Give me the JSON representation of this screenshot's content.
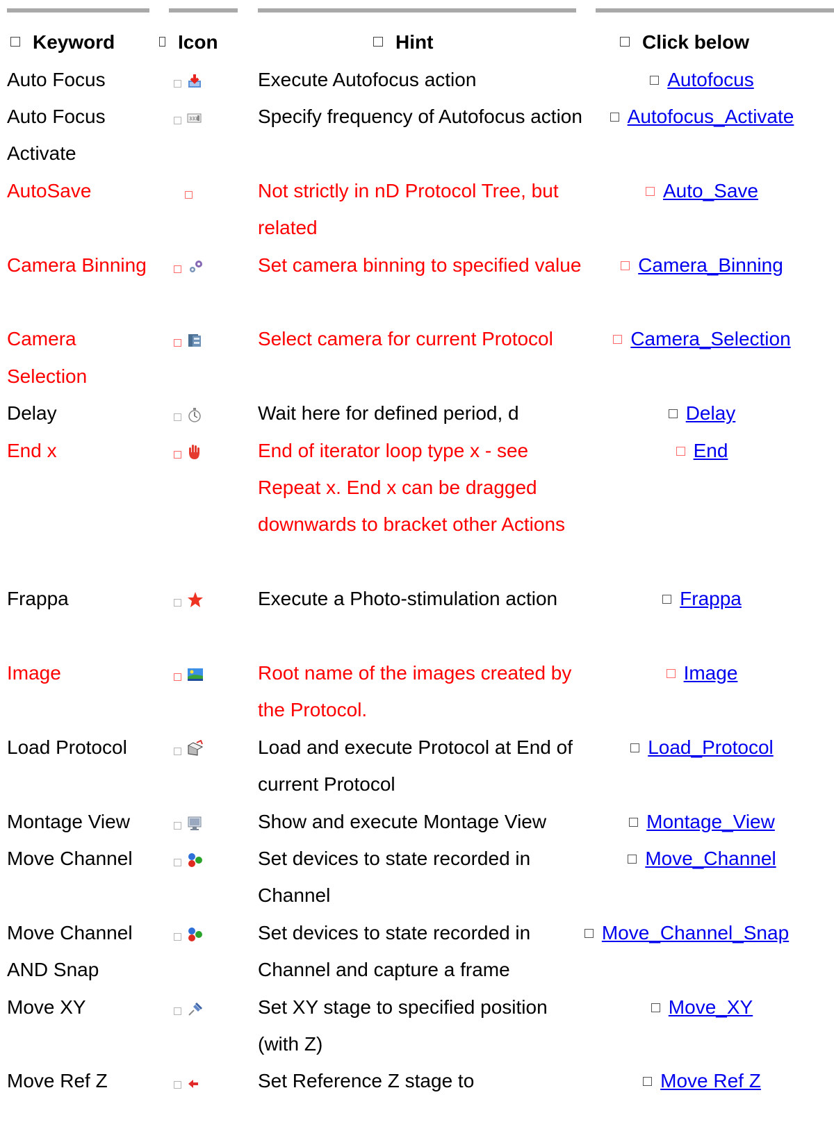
{
  "header": {
    "keyword": "Keyword",
    "icon": "Icon",
    "hint": "Hint",
    "click": "Click below"
  },
  "rows": [
    {
      "keyword": "Auto Focus",
      "icon": "autofocus-icon",
      "hint": "Execute Autofocus action",
      "link": "Autofocus",
      "red": false
    },
    {
      "keyword": "Auto Focus Activate",
      "icon": "frequency-counter-icon",
      "hint": "Specify frequency of Autofocus action",
      "link": "Autofocus_Activate",
      "red": false
    },
    {
      "keyword": "AutoSave",
      "icon": "",
      "hint": "Not strictly in nD Protocol Tree, but related",
      "link": "Auto_Save",
      "red": true
    },
    {
      "keyword": "Camera Binning",
      "icon": "gears-icon",
      "hint": "Set camera binning to specified value",
      "link": "Camera_Binning",
      "red": true
    },
    {
      "keyword": "Camera Selection",
      "icon": "camera-selection-icon",
      "hint": "Select camera for current Protocol",
      "link": "Camera_Selection",
      "red": true
    },
    {
      "keyword": "Delay",
      "icon": "stopwatch-icon",
      "hint": "Wait here for defined period, d",
      "link": "Delay",
      "red": false
    },
    {
      "keyword": "End x",
      "icon": "red-hand-icon",
      "hint": "End of iterator loop type x - see Repeat x. End x can be dragged downwards to bracket other Actions",
      "link": "End",
      "red": true
    },
    {
      "keyword": "Frappa",
      "icon": "red-star-icon",
      "hint": "Execute a Photo-stimulation action",
      "link": "Frappa",
      "red": false
    },
    {
      "keyword": "Image",
      "icon": "landscape-image-icon",
      "hint": "Root name of the images created by the Protocol.",
      "link": "Image",
      "red": true
    },
    {
      "keyword": "Load Protocol",
      "icon": "load-protocol-icon",
      "hint": "Load and execute Protocol at End of current Protocol",
      "link": "Load_Protocol",
      "red": false
    },
    {
      "keyword": "Montage View",
      "icon": "monitor-icon",
      "hint": "Show and execute Montage View",
      "link": "Montage_View",
      "red": false
    },
    {
      "keyword": "Move Channel",
      "icon": "rgb-dots-icon",
      "hint": "Set devices to state recorded in Channel",
      "link": "Move_Channel",
      "red": false
    },
    {
      "keyword": "Move Channel AND Snap",
      "icon": "rgb-dots-icon",
      "hint": "Set devices to state recorded in Channel and capture a frame",
      "link": "Move_Channel_Snap",
      "red": false
    },
    {
      "keyword": "Move XY",
      "icon": "pushpin-icon",
      "hint": "Set XY stage to specified position (with Z)",
      "link": "Move_XY",
      "red": false
    },
    {
      "keyword": "Move Ref Z",
      "icon": "red-left-arrow-icon",
      "hint": "Set Reference Z stage to",
      "link": "Move Ref Z",
      "red": false
    }
  ]
}
